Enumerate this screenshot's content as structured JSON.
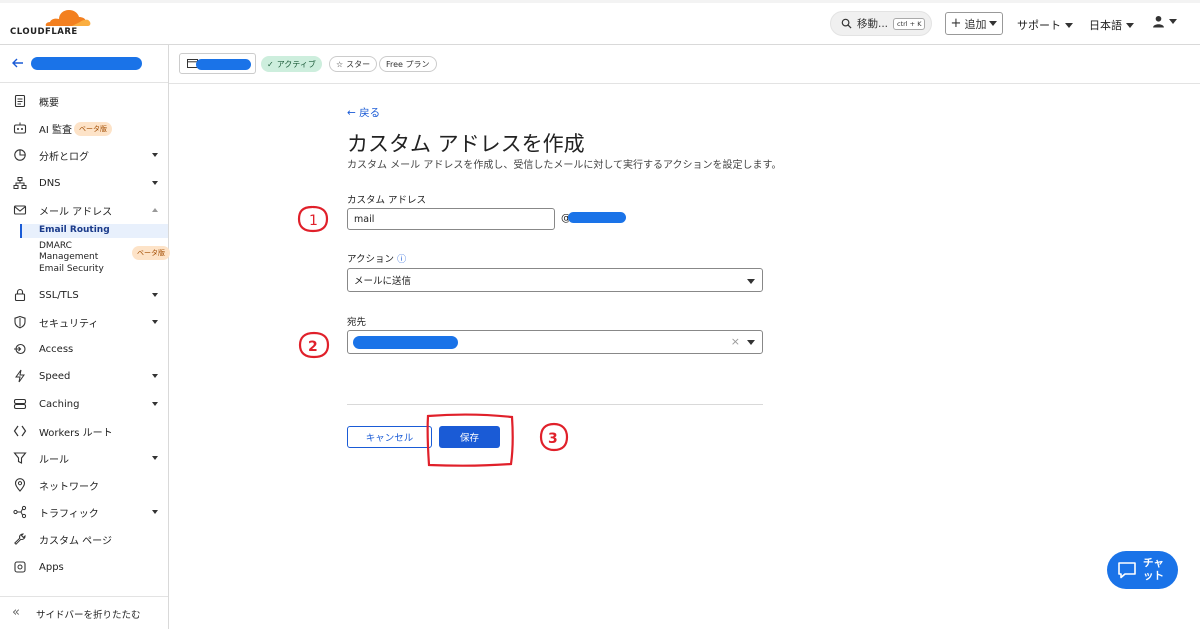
{
  "topbar": {
    "logo_text": "CLOUDFLARE",
    "search_label": "移動...",
    "search_shortcut": "ctrl + K",
    "add_label": "追加",
    "support_label": "サポート",
    "language_label": "日本語"
  },
  "sidebar": {
    "items": [
      {
        "label": "概要",
        "icon": "document-icon",
        "caret": false
      },
      {
        "label": "AI 監査",
        "icon": "bot-icon",
        "caret": false,
        "badge": "ベータ版"
      },
      {
        "label": "分析とログ",
        "icon": "chart-pie-icon",
        "caret": true
      },
      {
        "label": "DNS",
        "icon": "network-icon",
        "caret": true
      },
      {
        "label": "メール アドレス",
        "icon": "mail-icon",
        "caret": true,
        "expanded": true
      },
      {
        "label": "SSL/TLS",
        "icon": "lock-icon",
        "caret": true
      },
      {
        "label": "セキュリティ",
        "icon": "shield-icon",
        "caret": true
      },
      {
        "label": "Access",
        "icon": "access-icon",
        "caret": false
      },
      {
        "label": "Speed",
        "icon": "bolt-icon",
        "caret": true
      },
      {
        "label": "Caching",
        "icon": "database-icon",
        "caret": true
      },
      {
        "label": "Workers ルート",
        "icon": "workers-icon",
        "caret": false
      },
      {
        "label": "ルール",
        "icon": "funnel-icon",
        "caret": true
      },
      {
        "label": "ネットワーク",
        "icon": "location-icon",
        "caret": false
      },
      {
        "label": "トラフィック",
        "icon": "share-icon",
        "caret": true
      },
      {
        "label": "カスタム ページ",
        "icon": "wrench-icon",
        "caret": false
      },
      {
        "label": "Apps",
        "icon": "apps-icon",
        "caret": false
      }
    ],
    "email_subitems": [
      "Email Routing",
      "DMARC Management",
      "Email Security"
    ],
    "dmarc_badge": "ベータ版",
    "collapse_label": "サイドバーを折りたたむ"
  },
  "zonebar": {
    "status": "アクティブ",
    "star": "スター",
    "plan": "Free プラン"
  },
  "form": {
    "back": "戻る",
    "title": "カスタム アドレスを作成",
    "description": "カスタム メール アドレスを作成し、受信したメールに対して実行するアクションを設定します。",
    "custom_address_label": "カスタム アドレス",
    "custom_address_value": "mail",
    "at_sign": "@",
    "action_label": "アクション",
    "action_value": "メールに送信",
    "destination_label": "宛先",
    "cancel_label": "キャンセル",
    "save_label": "保存"
  },
  "chat": {
    "label_line1": "チャ",
    "label_line2": "ット"
  },
  "annotations": [
    "1",
    "2",
    "3"
  ],
  "colors": {
    "accent": "#1a5bd6",
    "active_green": "#cdeedd",
    "annotation_red": "#e0202a",
    "redaction_blue": "#1a73e8"
  }
}
